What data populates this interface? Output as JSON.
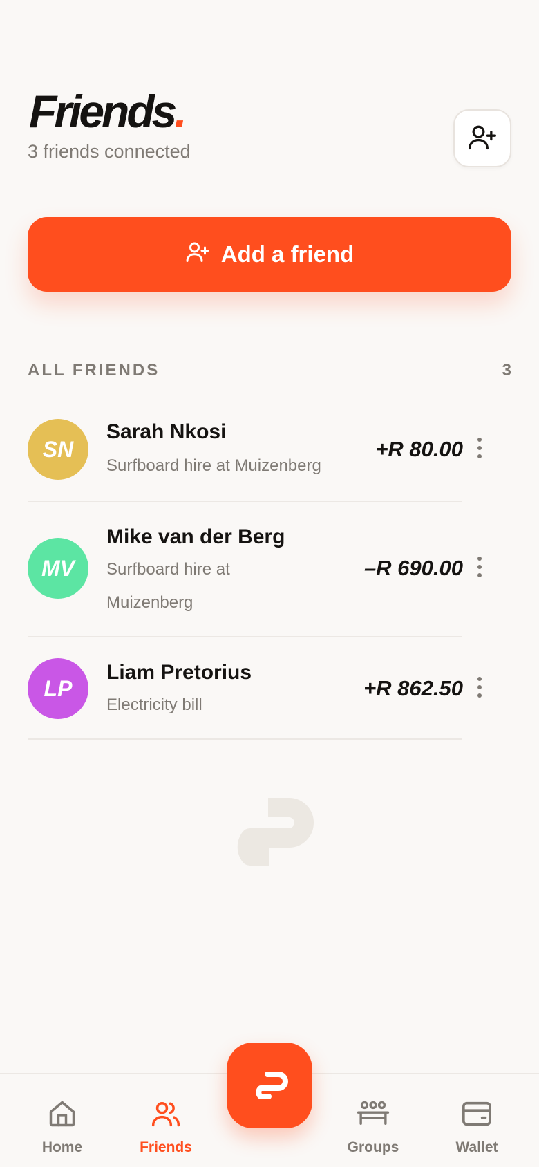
{
  "header": {
    "title": "Friends",
    "title_dot": ".",
    "subtitle": "3 friends connected",
    "add_icon": "user-plus-icon"
  },
  "add_friend_button": {
    "label": "Add a friend",
    "icon": "user-plus-icon"
  },
  "section": {
    "label": "ALL FRIENDS",
    "count": "3"
  },
  "friends": [
    {
      "initials": "SN",
      "name": "Sarah Nkosi",
      "description": "Surfboard hire at Muizenberg",
      "amount": "+R 80.00",
      "avatar_color": "#E5BF55"
    },
    {
      "initials": "MV",
      "name": "Mike van der Berg",
      "description": "Surfboard hire at Muizenberg",
      "amount": "–R 690.00",
      "avatar_color": "#5CE5A3"
    },
    {
      "initials": "LP",
      "name": "Liam Pretorius",
      "description": "Electricity bill",
      "amount": "+R 862.50",
      "avatar_color": "#C957E6"
    }
  ],
  "bottom_nav": {
    "items": [
      {
        "label": "Home",
        "icon": "home-icon",
        "active": false
      },
      {
        "label": "Friends",
        "icon": "friends-icon",
        "active": true
      },
      {
        "label": "Groups",
        "icon": "groups-icon",
        "active": false
      },
      {
        "label": "Wallet",
        "icon": "wallet-icon",
        "active": false
      }
    ],
    "fab_icon": "logo-icon"
  },
  "colors": {
    "accent": "#FF4E1E",
    "background": "#FAF8F6",
    "text": "#151311",
    "muted": "#7F7A74"
  }
}
